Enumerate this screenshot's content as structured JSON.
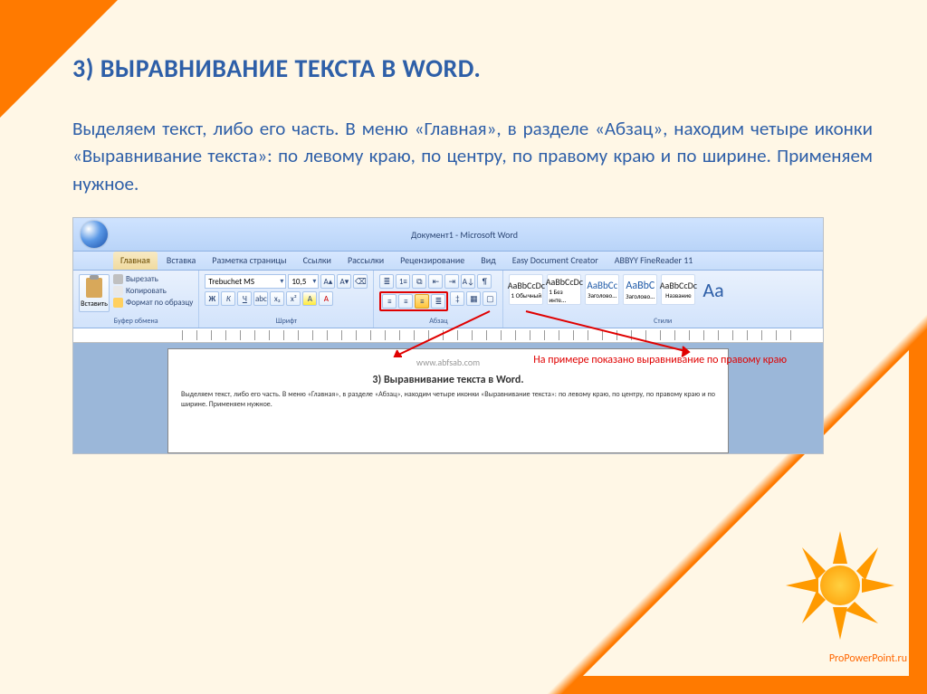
{
  "title": "3) ВЫРАВНИВАНИЕ ТЕКСТА В WORD.",
  "description": "Выделяем текст, либо его часть. В меню «Главная», в разделе «Абзац», находим четыре иконки «Выравнивание текста»: по левому краю, по центру, по правому краю и по ширине. Применяем нужное.",
  "word": {
    "doc_title": "Документ1 - Microsoft Word",
    "tabs": [
      "Главная",
      "Вставка",
      "Разметка страницы",
      "Ссылки",
      "Рассылки",
      "Рецензирование",
      "Вид",
      "Easy Document Creator",
      "ABBYY FineReader 11"
    ],
    "clipboard": {
      "paste": "Вставить",
      "cut": "Вырезать",
      "copy": "Копировать",
      "format_painter": "Формат по образцу",
      "label": "Буфер обмена"
    },
    "font": {
      "name": "Trebuchet MS",
      "size": "10,5",
      "label": "Шрифт"
    },
    "paragraph": {
      "label": "Абзац"
    },
    "styles": {
      "items": [
        "1 Обычный",
        "1 Без инте...",
        "Заголово...",
        "Заголово...",
        "Название"
      ],
      "samples": [
        "AaBbCcDc",
        "AaBbCcDc",
        "AaBbCc",
        "AaBbC",
        "AaBbCcDc"
      ],
      "label": "Стили"
    },
    "callout": "На примере показано выравнивание по правому краю",
    "watermark": "www.abfsab.com",
    "example_title": "3) Выравнивание текста в Word.",
    "example_body": "Выделяем текст, либо его часть. В меню «Главная», в разделе «Абзац», находим четыре иконки «Выравнивание текста»: по левому краю, по центру, по правому краю и по ширине. Применяем нужное."
  },
  "footer": "ProPowerPoint.ru"
}
